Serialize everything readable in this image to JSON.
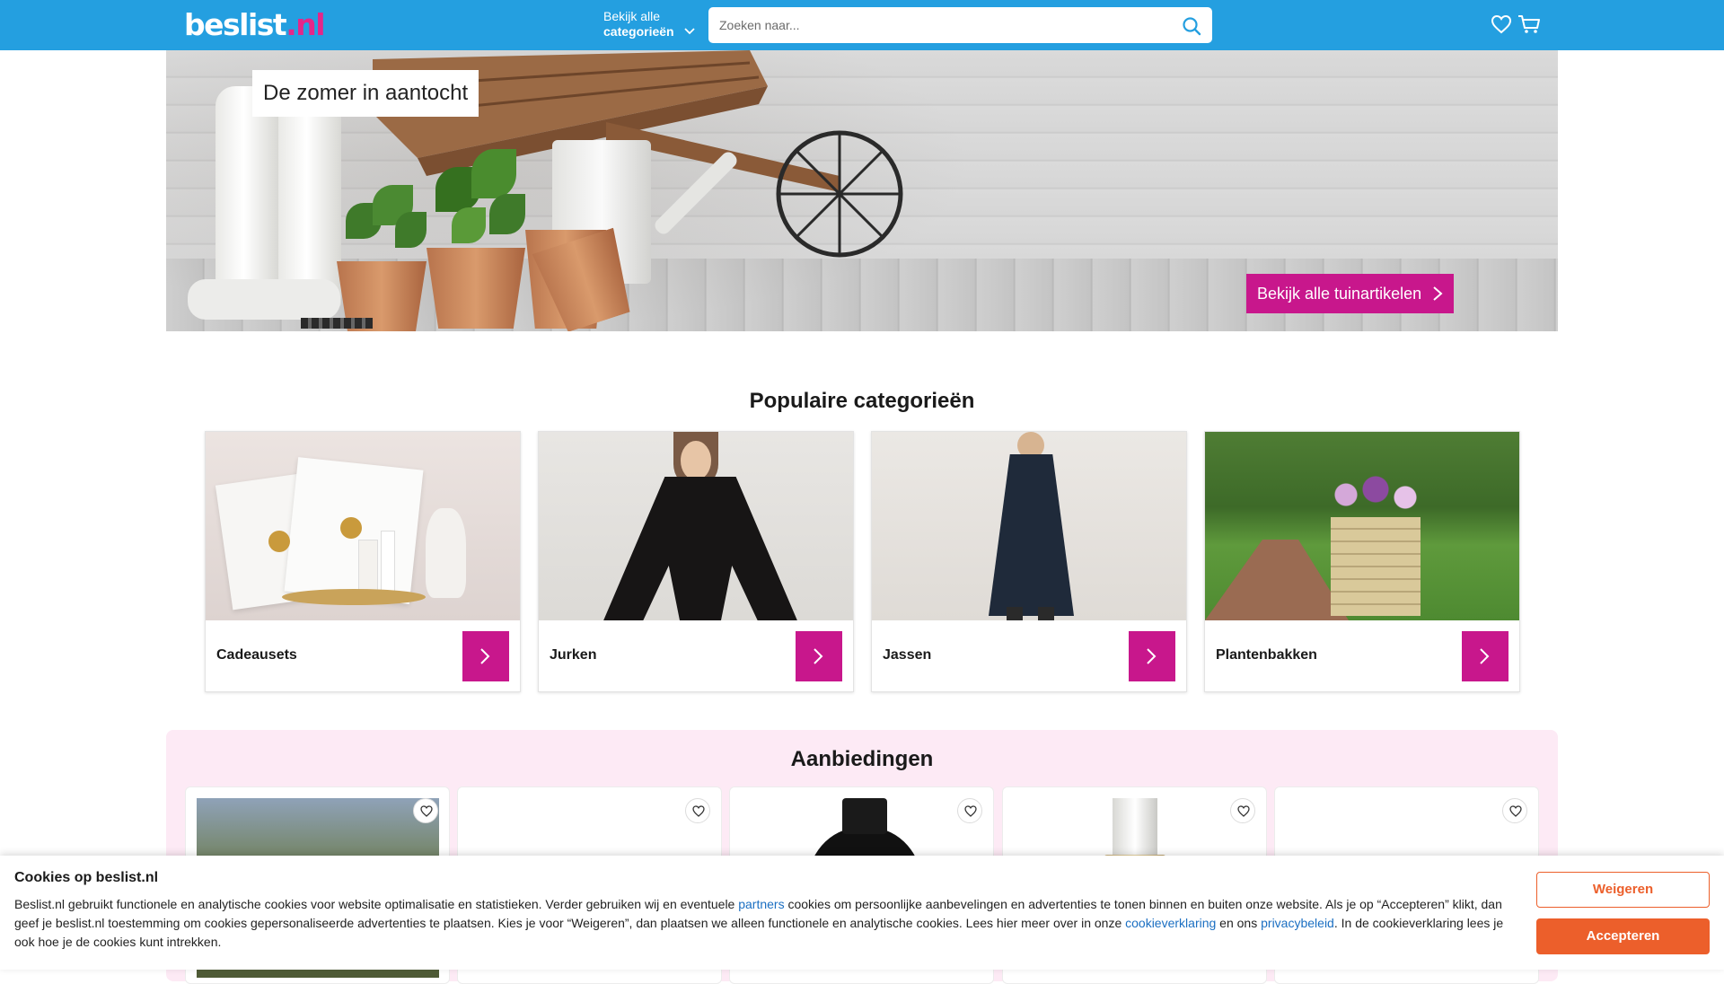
{
  "header": {
    "logo_main": "beslist",
    "logo_tld": ".nl",
    "categories_line1": "Bekijk alle",
    "categories_line2": "categorieën",
    "search_placeholder": "Zoeken naar..."
  },
  "hero": {
    "title": "De zomer in aantocht",
    "cta_label": "Bekijk alle tuinartikelen"
  },
  "popular": {
    "title": "Populaire categorieën",
    "items": [
      {
        "label": "Cadeausets"
      },
      {
        "label": "Jurken"
      },
      {
        "label": "Jassen"
      },
      {
        "label": "Plantenbakken"
      }
    ]
  },
  "offers": {
    "title": "Aanbiedingen"
  },
  "cookie": {
    "title": "Cookies op beslist.nl",
    "text_1": "Beslist.nl gebruikt functionele en analytische cookies voor website optimalisatie en statistieken. Verder gebruiken wij en eventuele ",
    "link_partners": "partners",
    "text_2": " cookies om persoonlijke aanbevelingen en advertenties te tonen binnen en buiten onze website. Als je op “Accepteren” klikt, dan geef je beslist.nl toestemming om cookies gepersonaliseerde advertenties te plaatsen. Kies je voor “Weigeren”, dan plaatsen we alleen functionele en analytische cookies. Lees hier meer over in onze ",
    "link_cookie": "cookieverklaring",
    "text_3": " en ons ",
    "link_privacy": "privacybeleid",
    "text_4": ". In de cookieverklaring lees je ook hoe je de cookies kunt intrekken.",
    "refuse_label": "Weigeren",
    "accept_label": "Accepteren"
  },
  "colors": {
    "header_blue": "#249fe0",
    "brand_magenta": "#c8178c",
    "cookie_orange": "#ec5f2b",
    "offers_bg": "#fdeaf5"
  }
}
